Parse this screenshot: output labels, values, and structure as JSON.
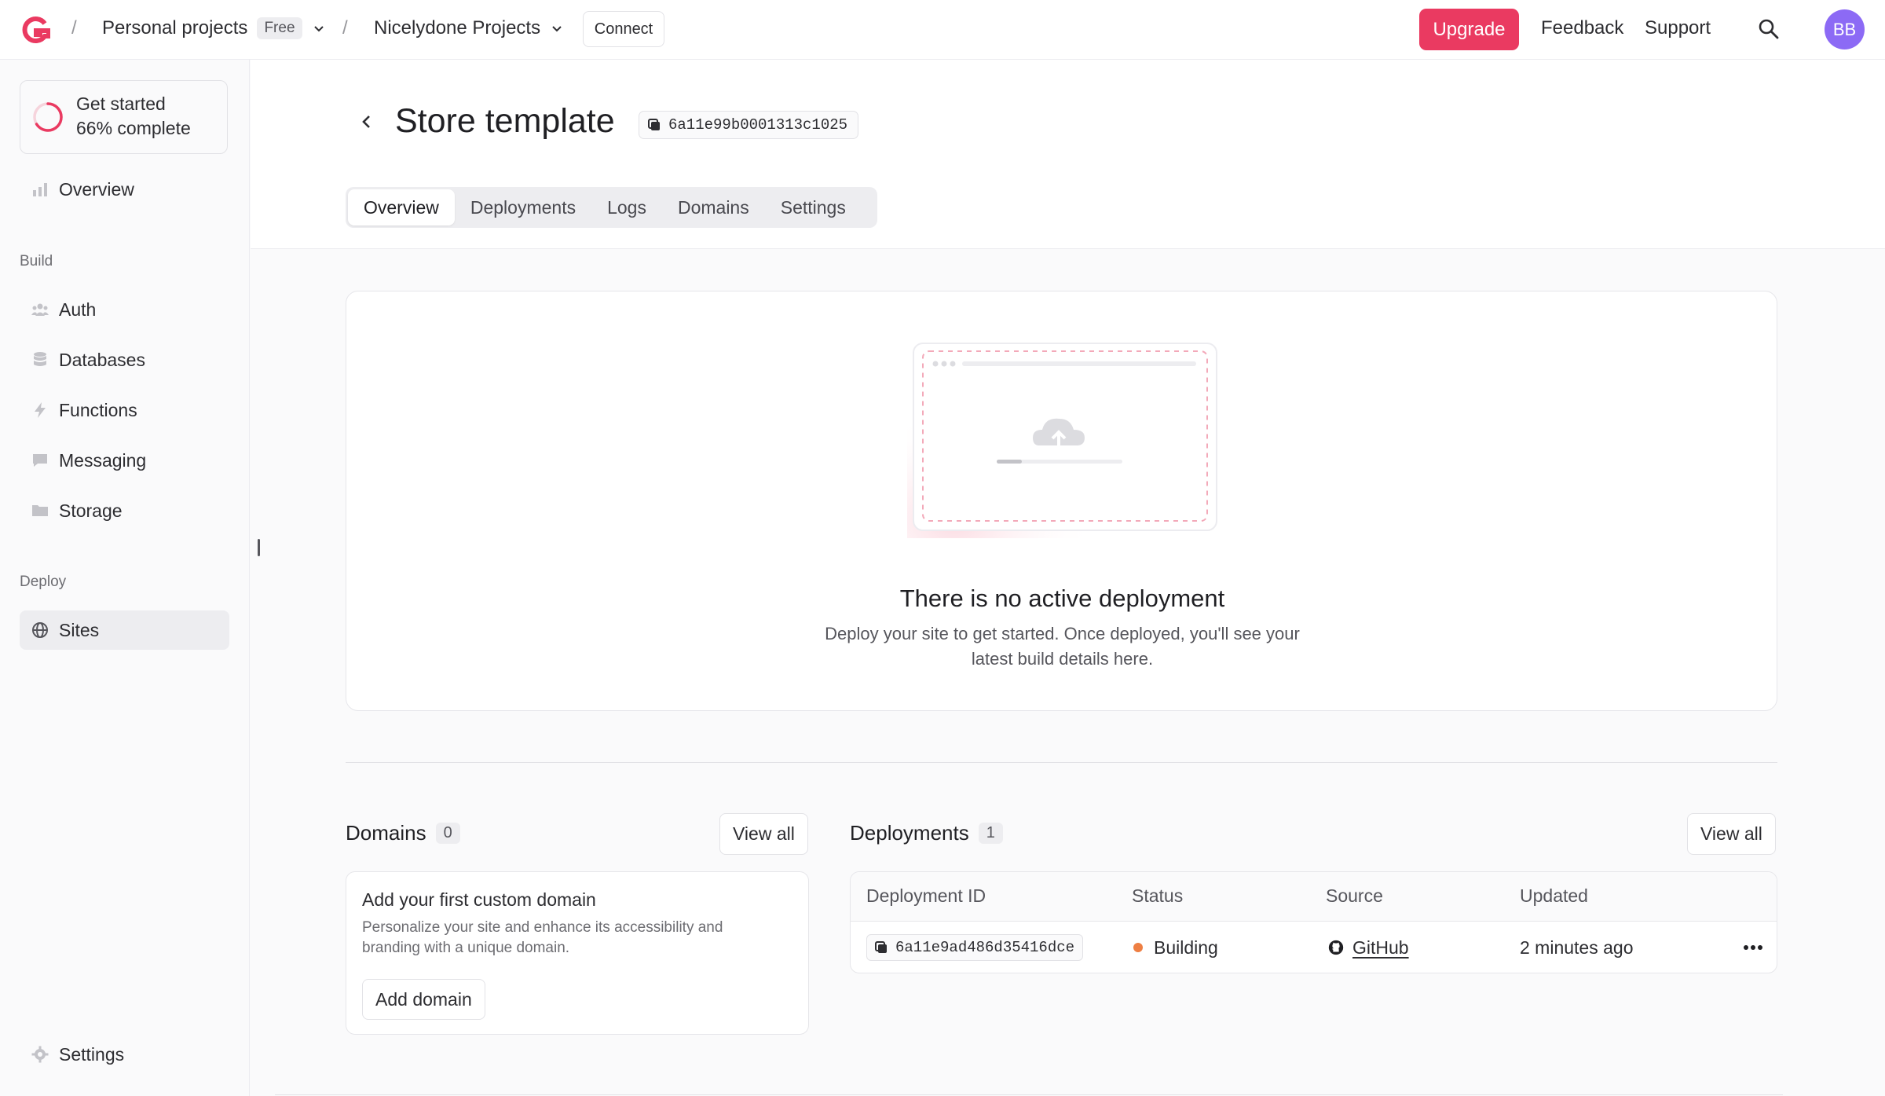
{
  "topbar": {
    "breadcrumbs": [
      {
        "label": "Personal projects",
        "tag": "Free"
      },
      {
        "label": "Nicelydone Projects"
      }
    ],
    "connect_label": "Connect",
    "upgrade_label": "Upgrade",
    "feedback_label": "Feedback",
    "support_label": "Support",
    "avatar_initials": "BB"
  },
  "sidebar": {
    "progress": {
      "line1": "Get started",
      "line2": "66% complete",
      "fraction": 0.66
    },
    "overview_label": "Overview",
    "build_section": "Build",
    "build_items": [
      "Auth",
      "Databases",
      "Functions",
      "Messaging",
      "Storage"
    ],
    "deploy_section": "Deploy",
    "sites_label": "Sites",
    "settings_label": "Settings"
  },
  "page": {
    "title": "Store template",
    "site_id": "6a11e99b0001313c1025",
    "tabs": [
      "Overview",
      "Deployments",
      "Logs",
      "Domains",
      "Settings"
    ],
    "active_tab": "Overview"
  },
  "empty_state": {
    "title": "There is no active deployment",
    "description": "Deploy your site to get started. Once deployed, you'll see your latest build details here."
  },
  "domains": {
    "title": "Domains",
    "count": "0",
    "view_all": "View all",
    "card_title": "Add your first custom domain",
    "card_desc": "Personalize your site and enhance its accessibility and branding with a unique domain.",
    "add_label": "Add domain"
  },
  "deployments": {
    "title": "Deployments",
    "count": "1",
    "view_all": "View all",
    "columns": [
      "Deployment ID",
      "Status",
      "Source",
      "Updated"
    ],
    "rows": [
      {
        "id": "6a11e9ad486d35416dce",
        "status": "Building",
        "source": "GitHub",
        "updated": "2 minutes ago"
      }
    ]
  },
  "colors": {
    "accent": "#ea3a61",
    "avatar": "#8c6af5",
    "status_building": "#ee7f43"
  }
}
